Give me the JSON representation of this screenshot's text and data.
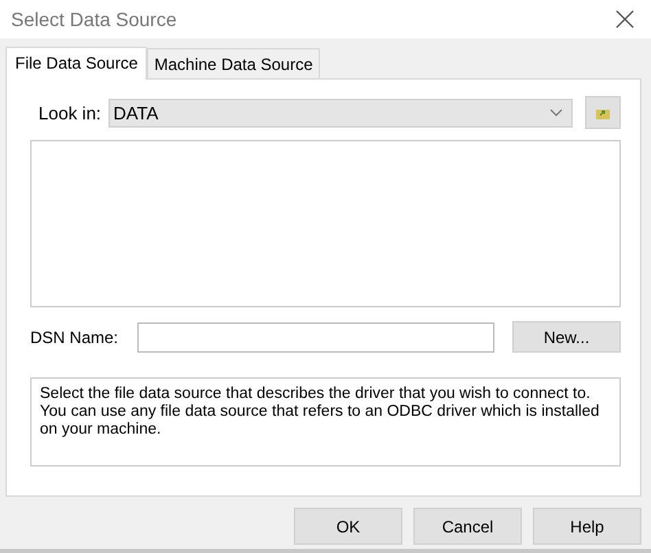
{
  "window": {
    "title": "Select Data Source"
  },
  "tabs": [
    {
      "label": "File Data Source",
      "selected": true
    },
    {
      "label": "Machine Data Source",
      "selected": false
    }
  ],
  "look_in": {
    "label": "Look in:",
    "value": "DATA"
  },
  "dsn_name": {
    "label": "DSN Name:"
  },
  "new_button": "New...",
  "description": "Select the file data source that describes the driver that you wish to connect to. You can use any file data source that refers to an ODBC driver which is installed on your machine.",
  "buttons": [
    "OK",
    "Cancel",
    "Help"
  ]
}
